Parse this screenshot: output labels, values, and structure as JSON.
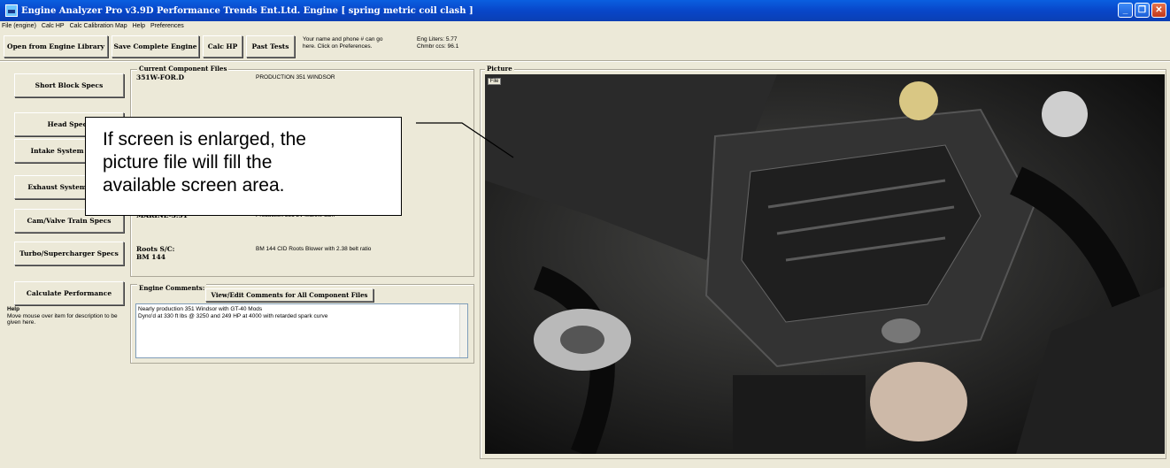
{
  "window": {
    "title": "Engine Analyzer Pro v3.9D   Performance Trends Ent.Ltd.    Engine [ spring metric coil clash ]",
    "icon": "engine-app-icon"
  },
  "menu": [
    "File (engine)",
    "Calc HP",
    "Calc Calibration Map",
    "Help",
    "Preferences"
  ],
  "toolbar": {
    "open_label": "Open from Engine Library",
    "save_label": "Save Complete Engine",
    "calc_label": "Calc HP",
    "past_label": "Past Tests",
    "name_note_1": "Your name and phone # can go",
    "name_note_2": "here.  Click on Preferences.",
    "eng_liters": "Eng Liters:  5.77",
    "chmbr_ccs": "Chmbr ccs:  96.1"
  },
  "specs": {
    "short_block": "Short Block Specs",
    "head": "Head Specs",
    "intake": "Intake System Specs",
    "exhaust": "Exhaust System Specs",
    "cam": "Cam/Valve Train Specs",
    "turbo": "Turbo/Supercharger Specs",
    "calc": "Calculate Performance"
  },
  "help": {
    "title": "Help",
    "text": "Move mouse over item for description to be given here."
  },
  "components": {
    "label": "Current Component Files",
    "short_block_file": "351W-FOR.D",
    "short_block_desc": "PRODUCTION 351 WINDSOR",
    "cam_file": "MARINE-3.51",
    "cam_desc": "Production 351 2V Marine cam",
    "sc_file_line1": "Roots S/C:",
    "sc_file_line2": "BM 144",
    "sc_desc": "BM 144 CID Roots Blower with 2.38 belt ratio"
  },
  "comments": {
    "label": "Engine Comments:",
    "view_button": "View/Edit Comments for All Component Files",
    "line1": "Nearly production 351 Windsor with GT-40 Mods",
    "line2": "Dyno'd at 330 ft lbs @ 3250 and 249 HP at 4000 with retarded spark curve"
  },
  "picture": {
    "label": "Picture",
    "file_button": "File"
  },
  "callout": {
    "line1": "If screen is enlarged, the",
    "line2": "picture file will fill the",
    "line3": "available screen area."
  }
}
